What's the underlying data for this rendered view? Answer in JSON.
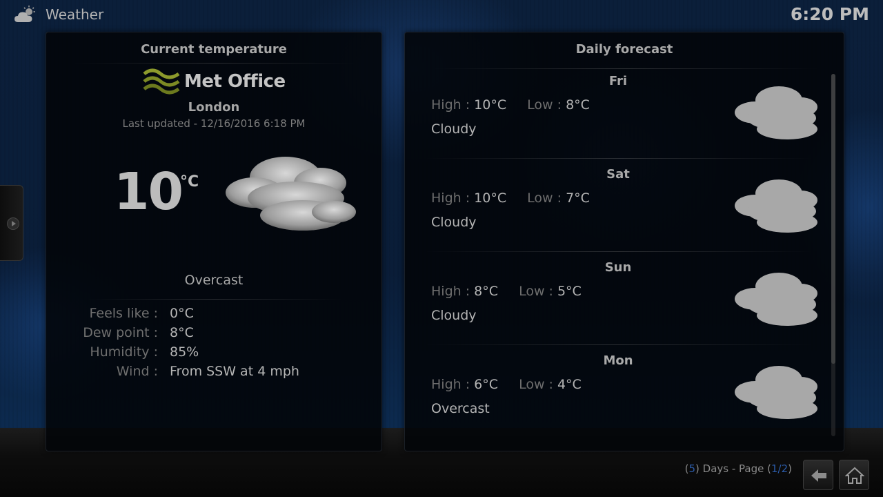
{
  "header": {
    "title": "Weather",
    "icon": "weather-cloud-sun-icon",
    "clock": "6:20 PM"
  },
  "current": {
    "panel_title": "Current temperature",
    "provider": "Met Office",
    "location": "London",
    "last_updated": "Last updated - 12/16/2016 6:18 PM",
    "temperature": "10",
    "unit": "°C",
    "condition": "Overcast",
    "condition_icon": "cloud-icon",
    "details": [
      {
        "label": "Feels like :",
        "value": "0°C"
      },
      {
        "label": "Dew point :",
        "value": "8°C"
      },
      {
        "label": "Humidity :",
        "value": "85%"
      },
      {
        "label": "Wind :",
        "value": "From SSW at 4 mph"
      }
    ]
  },
  "forecast": {
    "panel_title": "Daily forecast",
    "high_label": "High :",
    "low_label": "Low :",
    "days": [
      {
        "day": "Fri",
        "high": "10°C",
        "low": "8°C",
        "condition": "Cloudy",
        "icon": "cloud-icon"
      },
      {
        "day": "Sat",
        "high": "10°C",
        "low": "7°C",
        "condition": "Cloudy",
        "icon": "cloud-icon"
      },
      {
        "day": "Sun",
        "high": "8°C",
        "low": "5°C",
        "condition": "Cloudy",
        "icon": "cloud-icon"
      },
      {
        "day": "Mon",
        "high": "6°C",
        "low": "4°C",
        "condition": "Overcast",
        "icon": "cloud-icon"
      }
    ]
  },
  "footer": {
    "days_open": "(",
    "days_count": "5",
    "days_text": ") Days - Page (",
    "page_current": "1",
    "page_sep": "/",
    "page_total": "2",
    "page_close": ")",
    "back_icon": "back-arrow-icon",
    "home_icon": "home-icon"
  },
  "colors": {
    "accent": "#2b5ba8",
    "panel_bg": "#020408",
    "background": "#0b1f3a"
  }
}
